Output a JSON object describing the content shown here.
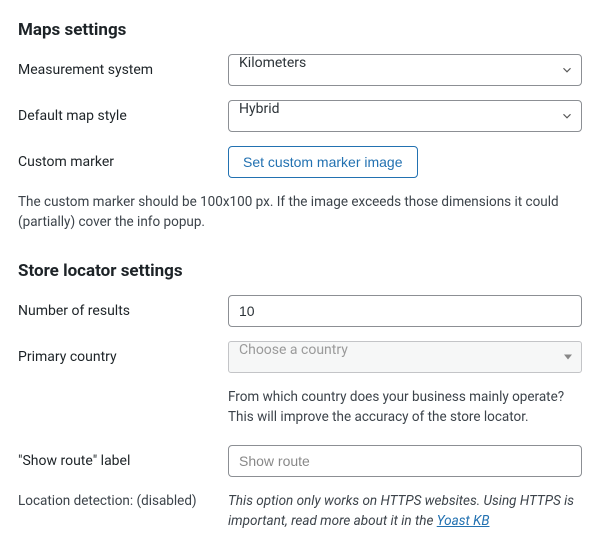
{
  "maps": {
    "heading": "Maps settings",
    "measurement_label": "Measurement system",
    "measurement_value": "Kilometers",
    "style_label": "Default map style",
    "style_value": "Hybrid",
    "marker_label": "Custom marker",
    "marker_button": "Set custom marker image",
    "marker_help": "The custom marker should be 100x100 px. If the image exceeds those dimensions it could (partially) cover the info popup."
  },
  "locator": {
    "heading": "Store locator settings",
    "results_label": "Number of results",
    "results_value": "10",
    "country_label": "Primary country",
    "country_placeholder": "Choose a country",
    "country_help": "From which country does your business mainly operate? This will improve the accuracy of the store locator.",
    "route_label": "\"Show route\" label",
    "route_placeholder": "Show route",
    "detection_label": "Location detection: (disabled)",
    "detection_note_pre": "This option only works on HTTPS websites. Using HTTPS is important, read more about it in the ",
    "detection_link": "Yoast KB"
  }
}
